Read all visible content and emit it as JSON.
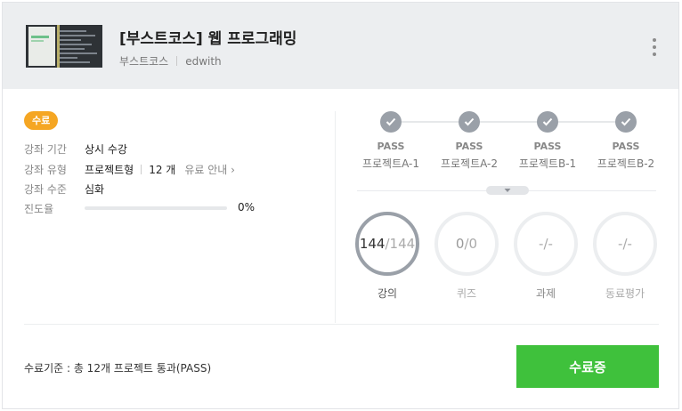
{
  "course": {
    "title": "[부스트코스] 웹 프로그래밍",
    "provider": "부스트코스",
    "platform": "edwith"
  },
  "status": {
    "badge": "수료",
    "badge_color": "#f5a623"
  },
  "info": [
    {
      "label": "강좌 기간",
      "value": "상시 수강"
    },
    {
      "label": "강좌 유형",
      "value": "프로젝트형",
      "count": "12 개",
      "link": "유료 안내 ›"
    },
    {
      "label": "강좌 수준",
      "value": "심화"
    }
  ],
  "progress": {
    "label": "진도율",
    "value": 0,
    "text": "0%"
  },
  "milestones": [
    {
      "status": "PASS",
      "name": "프로젝트A-1"
    },
    {
      "status": "PASS",
      "name": "프로젝트A-2"
    },
    {
      "status": "PASS",
      "name": "프로젝트B-1"
    },
    {
      "status": "PASS",
      "name": "프로젝트B-2"
    }
  ],
  "stats": [
    {
      "label": "강의",
      "done": "144",
      "total": "144",
      "complete": true
    },
    {
      "label": "퀴즈",
      "done": "0",
      "total": "0",
      "complete": false
    },
    {
      "label": "과제",
      "done": "-",
      "total": "-",
      "complete": false
    },
    {
      "label": "동료평가",
      "done": "-",
      "total": "-",
      "complete": false
    }
  ],
  "footer": {
    "criteria": "수료기준 : 총 12개 프로젝트 통과(PASS)",
    "certificate_button": "수료증"
  },
  "icons": {
    "more": "more-vertical-icon",
    "check": "check-icon",
    "expand": "chevron-down-icon"
  },
  "colors": {
    "accent": "#3fc13c",
    "badge": "#f5a623",
    "milestone": "#9aa0a8"
  }
}
